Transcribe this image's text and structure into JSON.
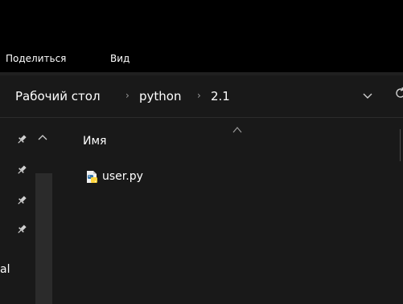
{
  "ribbon": {
    "share_label": "Поделиться",
    "view_label": "Вид"
  },
  "address": {
    "crumbs": [
      "Рабочий стол",
      "python",
      "2.1"
    ],
    "separator": "›"
  },
  "nav": {
    "partial_label": "al",
    "icons": [
      "pin-icon",
      "pin-icon",
      "pin-icon",
      "pin-icon"
    ]
  },
  "list": {
    "column_name": "Имя",
    "files": [
      {
        "name": "user.py",
        "icon": "python-file-icon"
      }
    ]
  },
  "colors": {
    "background": "#191919",
    "ribbon": "#000000",
    "text": "#ffffff",
    "muted": "#9a9a9a",
    "python_blue": "#3776ab",
    "python_yellow": "#ffd43b"
  }
}
